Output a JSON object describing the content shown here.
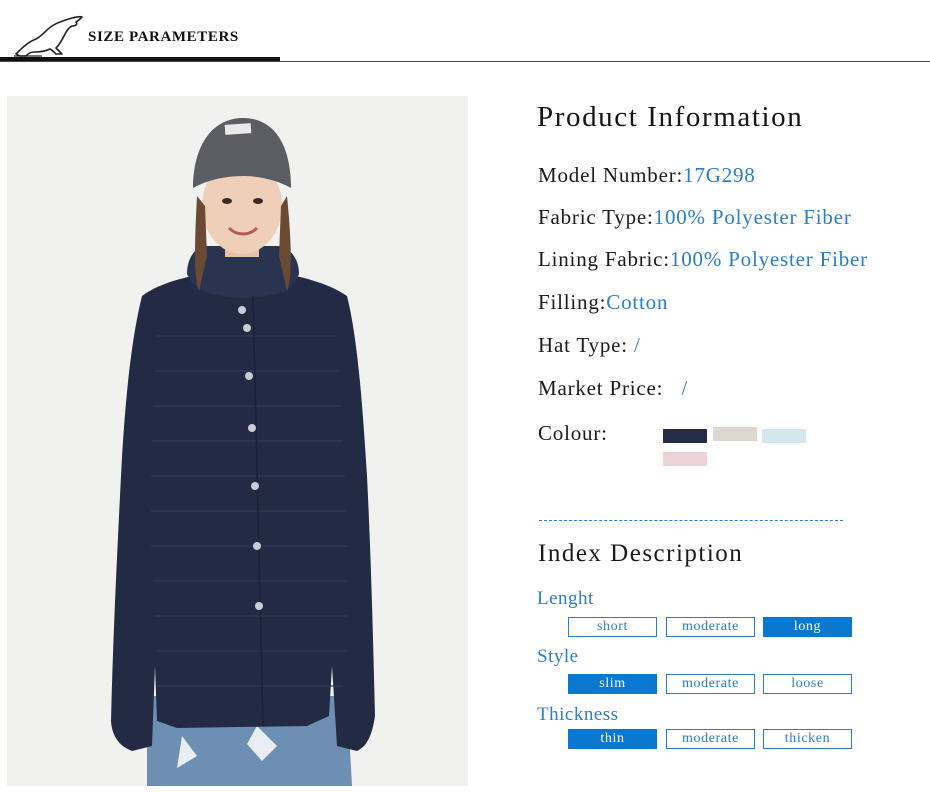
{
  "header": {
    "title": "SIZE PARAMETERS"
  },
  "product_info": {
    "title": "Product Information",
    "rows": [
      {
        "label": "Model Number:",
        "value": "17G298"
      },
      {
        "label": "Fabric Type:",
        "value": "100% Polyester Fiber"
      },
      {
        "label": "Lining Fabric:",
        "value": "100% Polyester Fiber"
      },
      {
        "label": "Filling:",
        "value": "Cotton"
      },
      {
        "label": "Hat Type: ",
        "value": "/"
      },
      {
        "label": "Market Price:   ",
        "value": "/"
      }
    ],
    "colour_label": "Colour:",
    "colours": [
      "#252d45",
      "#dcd7d0",
      "#d3e6ee",
      "#ebd3d8"
    ]
  },
  "index": {
    "title": "Index Description",
    "categories": [
      {
        "name": "Lenght",
        "options": [
          "short",
          "moderate",
          "long"
        ],
        "selected": "long"
      },
      {
        "name": "Style",
        "options": [
          "slim",
          "moderate",
          "loose"
        ],
        "selected": "slim"
      },
      {
        "name": "Thickness",
        "options": [
          "thin",
          "moderate",
          "thicken"
        ],
        "selected": "thin"
      }
    ]
  },
  "colors": {
    "accent": "#2a7ec9",
    "selected": "#0b78cf"
  }
}
